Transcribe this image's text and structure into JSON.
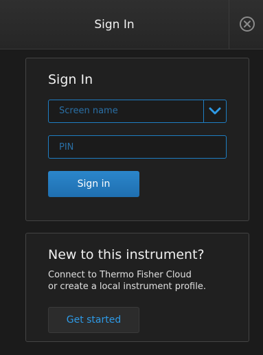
{
  "window": {
    "title": "Sign In",
    "close_icon": "close-circle-icon"
  },
  "signin_card": {
    "heading": "Sign In",
    "screen_name": {
      "placeholder": "Screen name",
      "value": "",
      "dropdown_icon": "chevron-down-icon"
    },
    "pin": {
      "placeholder": "PIN",
      "value": ""
    },
    "submit_label": "Sign in"
  },
  "new_card": {
    "heading": "New to this instrument?",
    "description_line1": "Connect to Thermo Fisher Cloud",
    "description_line2": "or create a local instrument profile.",
    "button_label": "Get started"
  },
  "colors": {
    "accent": "#1f7fc4",
    "primary_button": "#2479bd",
    "link_text": "#2e9ae6",
    "background": "#1b1b1b"
  }
}
